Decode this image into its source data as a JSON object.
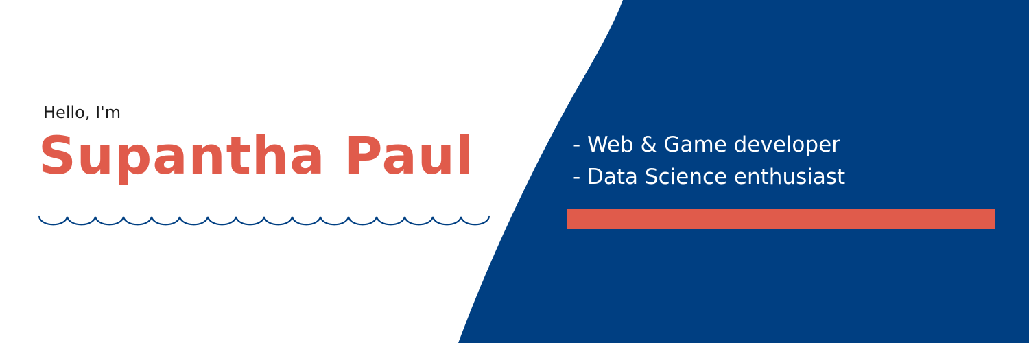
{
  "colors": {
    "background": "#ffffff",
    "panel": "#003f82",
    "accent": "#e05b4b",
    "wave": "#003f82",
    "greeting_text": "#1b1b1b",
    "role_text": "#ffffff"
  },
  "intro": {
    "greeting": "Hello, I'm",
    "name": "Supantha Paul"
  },
  "roles": [
    "- Web & Game developer",
    "- Data Science enthusiast"
  ]
}
